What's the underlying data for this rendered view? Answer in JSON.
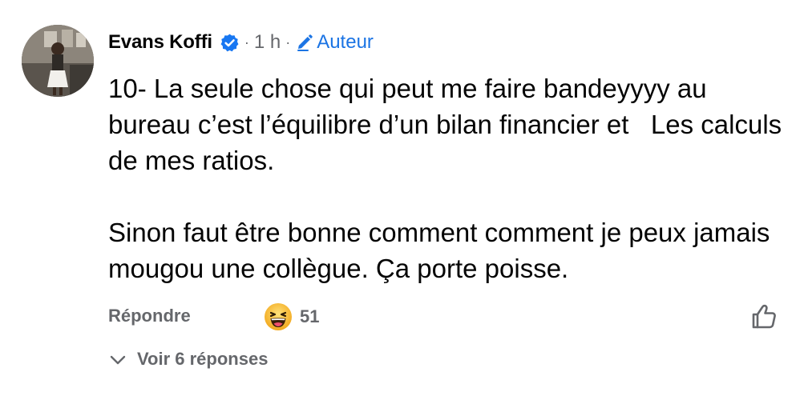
{
  "comment": {
    "author_name": "Evans Koffi",
    "time": "1 h",
    "separator": "·",
    "author_badge": "Auteur",
    "paragraphs": [
      "10- La seule chose qui peut me faire bandeyyyy au bureau c’est l’équilibre d’un bilan financier et   Les calculs de mes ratios.",
      "Sinon faut être bonne comment comment je peux jamais mougou une collègue. Ça porte poisse."
    ]
  },
  "actions": {
    "reply_label": "Répondre",
    "reaction_icon": "haha-emoji-icon",
    "reaction_count": "51",
    "like_icon": "thumbs-up-icon"
  },
  "replies": {
    "label": "Voir 6 réponses",
    "icon": "chevron-down-icon"
  },
  "colors": {
    "text_primary": "#050505",
    "text_secondary": "#65676b",
    "accent_blue": "#1b74e4",
    "verified_blue": "#1877f2",
    "haha_yellow": "#f7b928"
  }
}
